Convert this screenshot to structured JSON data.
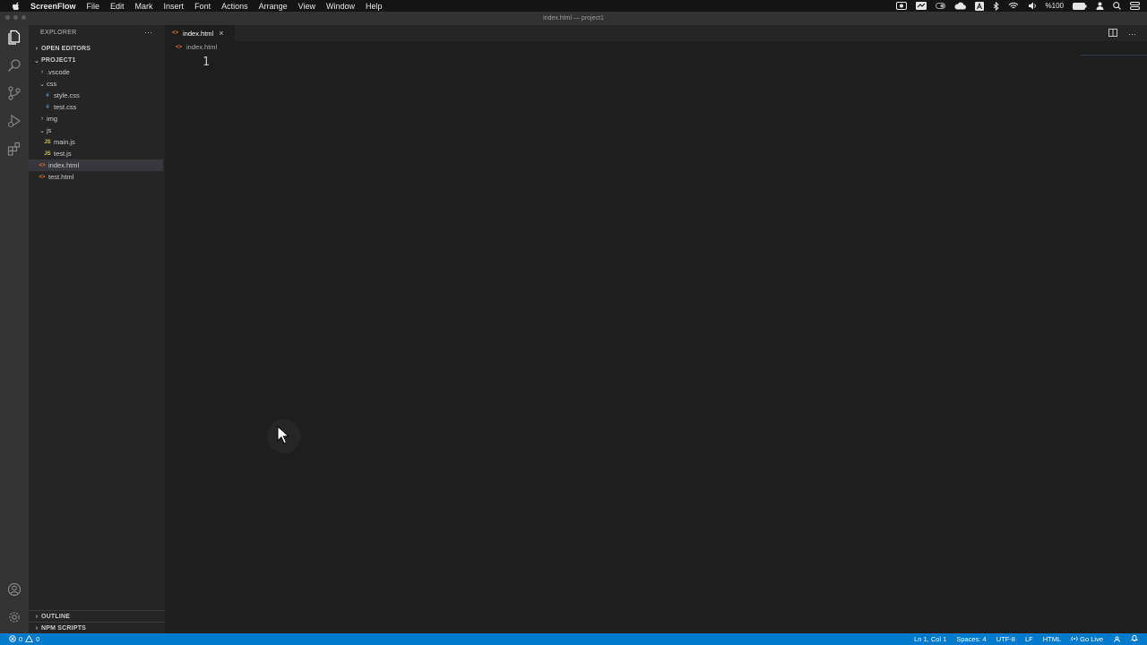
{
  "menubar": {
    "app_name": "ScreenFlow",
    "items": [
      "File",
      "Edit",
      "Mark",
      "Insert",
      "Font",
      "Actions",
      "Arrange",
      "View",
      "Window",
      "Help"
    ],
    "battery_percent": "%100"
  },
  "window": {
    "title": "index.html — project1"
  },
  "sidebar": {
    "title": "EXPLORER",
    "more": "···",
    "open_editors": "OPEN EDITORS",
    "project": "PROJECT1",
    "tree": [
      {
        "label": ".vscode",
        "type": "folder",
        "expanded": false
      },
      {
        "label": "css",
        "type": "folder",
        "expanded": true
      },
      {
        "label": "style.css",
        "type": "css"
      },
      {
        "label": "test.css",
        "type": "css"
      },
      {
        "label": "img",
        "type": "folder",
        "expanded": false
      },
      {
        "label": "js",
        "type": "folder",
        "expanded": true
      },
      {
        "label": "main.js",
        "type": "js"
      },
      {
        "label": "test.js",
        "type": "js"
      },
      {
        "label": "index.html",
        "type": "html",
        "selected": true
      },
      {
        "label": "test.html",
        "type": "html"
      }
    ],
    "outline": "OUTLINE",
    "npm_scripts": "NPM SCRIPTS"
  },
  "icons": {
    "css": "#",
    "js": "JS",
    "html": "<>"
  },
  "editor": {
    "tab_label": "index.html",
    "tab_close": "×",
    "breadcrumb": "index.html",
    "line_number": "1",
    "more_actions": "···"
  },
  "statusbar": {
    "errors": "0",
    "warnings": "0",
    "position": "Ln 1, Col 1",
    "spaces": "Spaces: 4",
    "encoding": "UTF-8",
    "eol": "LF",
    "language": "HTML",
    "go_live": "Go Live"
  },
  "colors": {
    "accent": "#007acc",
    "activity_bar": "#333333",
    "sidebar": "#252526",
    "editor": "#1e1e1e"
  }
}
